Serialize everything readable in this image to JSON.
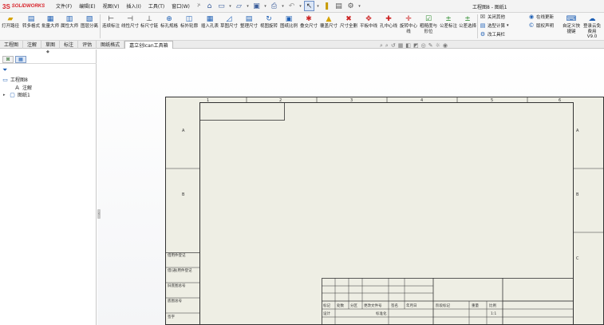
{
  "app": {
    "logo_mark": "3S",
    "logo_text": "SOLIDWORKS",
    "window_title": "工程图8 - 图纸1"
  },
  "menu": [
    "文件(F)",
    "编辑(E)",
    "视图(V)",
    "插入(I)",
    "工具(T)",
    "窗口(W)"
  ],
  "ribbon_buttons": [
    {
      "label": "打开路径"
    },
    {
      "label": "转多格式"
    },
    {
      "label": "批量大师"
    },
    {
      "label": "属性大师"
    },
    {
      "label": "图层分离"
    },
    {
      "label": "连续标注"
    },
    {
      "label": "线性尺寸"
    },
    {
      "label": "标尺寸链"
    },
    {
      "label": "标孔规格"
    },
    {
      "label": "标外轮廓"
    },
    {
      "label": "插入孔表"
    },
    {
      "label": "草图尺寸"
    },
    {
      "label": "整理尺寸"
    },
    {
      "label": "视图旋转"
    },
    {
      "label": "图纸比例"
    },
    {
      "label": "叠交尺寸"
    },
    {
      "label": "覆盖尺寸"
    },
    {
      "label": "尺寸全删"
    },
    {
      "label": "平板中线"
    },
    {
      "label": "孔中心线"
    },
    {
      "label": "旋转中心线"
    },
    {
      "label": "粗糙度与形位"
    },
    {
      "label": "公差标注"
    },
    {
      "label": "公差选择"
    }
  ],
  "ribbon_side_left": [
    {
      "label": "关闭其他"
    },
    {
      "label": "选型计算"
    },
    {
      "label": "改工具栏"
    }
  ],
  "ribbon_side_right": [
    {
      "label": "在线更新"
    },
    {
      "label": "版权声明"
    }
  ],
  "ribbon_last": [
    {
      "label": "自定义快捷键"
    },
    {
      "label": "登录云免费用",
      "sub": "V9.0"
    }
  ],
  "tabs": [
    "工程图",
    "注解",
    "草图",
    "标注",
    "评估",
    "图纸格式",
    "嘉立创Ican工具箱"
  ],
  "active_tab_index": 6,
  "tree": {
    "root": "工程图8",
    "items": [
      "注解",
      "图纸1"
    ]
  },
  "sheet": {
    "top_numbers": [
      "1",
      "2",
      "3",
      "4",
      "5",
      "6"
    ],
    "left_letters": [
      "A",
      "B",
      "C",
      "D"
    ],
    "left_table": [
      "借用件登记",
      "借(通)用件登记",
      "旧底图总号",
      "底图总号",
      "签字"
    ],
    "title_header": [
      "标记",
      "处数",
      "分区",
      "更改文件号",
      "签名",
      "年月日",
      "阶段标记",
      "重量",
      "比例"
    ],
    "title_row2": [
      "设计",
      "标准化",
      "1:1"
    ]
  },
  "icons": {
    "accent": "#1e5fb4",
    "warn": "#c22222"
  }
}
